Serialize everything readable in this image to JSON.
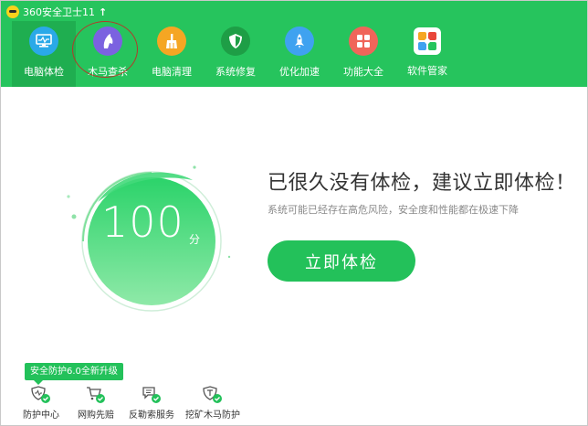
{
  "app": {
    "title": "360安全卫士11"
  },
  "nav": {
    "items": [
      {
        "label": "电脑体检",
        "icon": "monitor-icon",
        "color": "#2aa9e8",
        "active": true
      },
      {
        "label": "木马查杀",
        "icon": "horse-icon",
        "color": "#7b62e0"
      },
      {
        "label": "电脑清理",
        "icon": "broom-icon",
        "color": "#f5a623"
      },
      {
        "label": "系统修复",
        "icon": "shield-icon",
        "color": "#1e9e46"
      },
      {
        "label": "优化加速",
        "icon": "rocket-icon",
        "color": "#3fa2f0"
      },
      {
        "label": "功能大全",
        "icon": "grid-icon",
        "color": "#f0655a"
      },
      {
        "label": "软件管家",
        "icon": "flower-icon",
        "color": "#3bb56a"
      }
    ]
  },
  "score": {
    "value": "100",
    "unit": "分"
  },
  "main": {
    "headline": "已很久没有体检，建议立即体检！",
    "subline": "系统可能已经存在高危风险，安全度和性能都在极速下降",
    "cta_label": "立即体检"
  },
  "promo": {
    "label": "安全防护6.0全新升级"
  },
  "bottom": {
    "items": [
      {
        "label": "防护中心",
        "icon": "protection-center-icon"
      },
      {
        "label": "网购先赔",
        "icon": "shopping-cart-icon"
      },
      {
        "label": "反勒索服务",
        "icon": "anti-ransom-icon"
      },
      {
        "label": "挖矿木马防护",
        "icon": "mining-trojan-icon"
      }
    ]
  },
  "colors": {
    "brand": "#26c45d",
    "accent": "#23c15a"
  }
}
